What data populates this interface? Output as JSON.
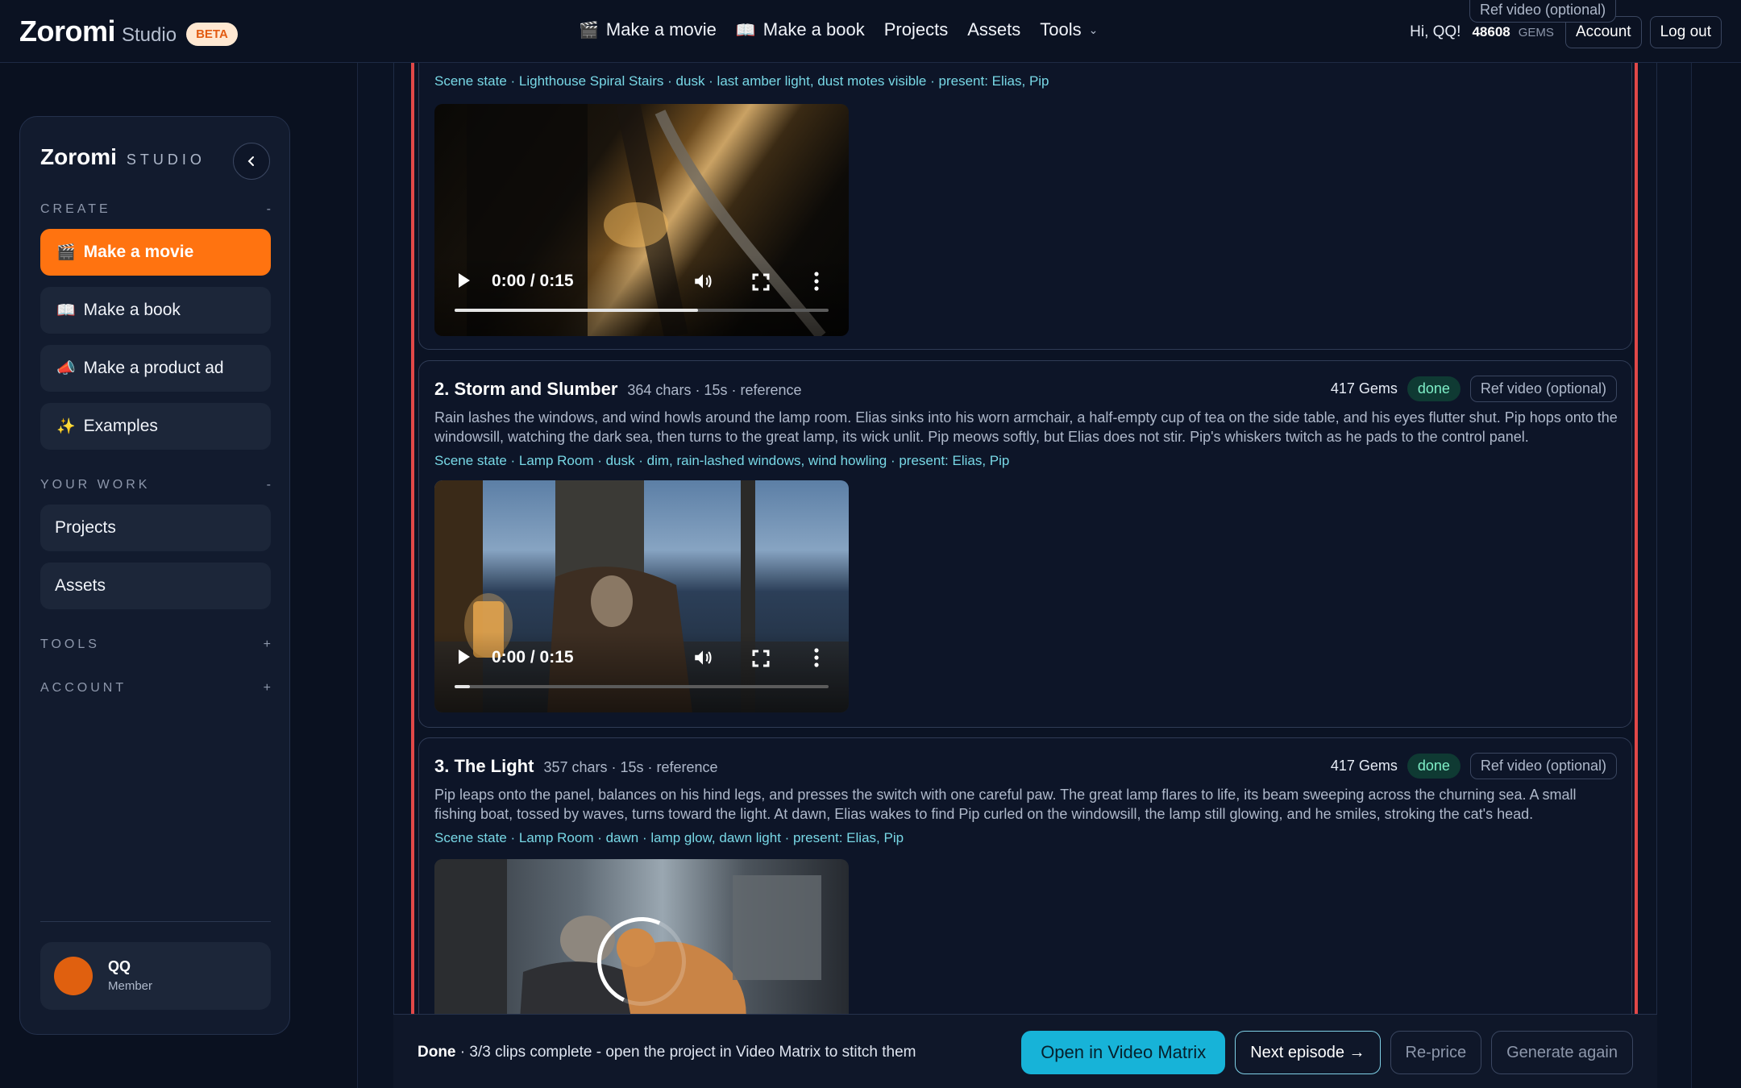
{
  "header": {
    "brand": "Zoromi",
    "brand_sub": "Studio",
    "beta": "BETA",
    "nav": [
      {
        "icon": "clapper-icon",
        "emoji": "🎬",
        "label": "Make a movie"
      },
      {
        "icon": "book-icon",
        "emoji": "📖",
        "label": "Make a book"
      },
      {
        "label": "Projects"
      },
      {
        "label": "Assets"
      },
      {
        "label": "Tools",
        "chevron": "⌄"
      }
    ],
    "greeting": "Hi, QQ!",
    "gems": "48608",
    "gems_unit": "GEMS",
    "account": "Account",
    "logout": "Log out",
    "floating_ref": "Ref video (optional)"
  },
  "sidebar": {
    "title": "Zoromi",
    "sub": "STUDIO",
    "collapse_glyph": "‹",
    "create_label": "CREATE",
    "create_toggle": "-",
    "create_items": [
      {
        "emoji": "🎬",
        "label": "Make a movie"
      },
      {
        "emoji": "📖",
        "label": "Make a book"
      },
      {
        "emoji": "📣",
        "label": "Make a product ad"
      },
      {
        "emoji": "✨",
        "label": "Examples"
      }
    ],
    "work_label": "YOUR WORK",
    "work_toggle": "-",
    "work_items": [
      {
        "label": "Projects"
      },
      {
        "label": "Assets"
      }
    ],
    "tools_label": "TOOLS",
    "tools_toggle": "+",
    "account_label": "ACCOUNT",
    "account_toggle": "+",
    "user": {
      "name": "QQ",
      "role": "Member"
    }
  },
  "clips": [
    {
      "scene": "Scene state · Lighthouse Spiral Stairs · dusk · last amber light, dust motes visible · present: Elias, Pip",
      "time": "0:00 / 0:15",
      "progress": 0.65
    },
    {
      "title": "2. Storm and Slumber",
      "meta": "364 chars · 15s · reference",
      "gems": "417 Gems",
      "status": "done",
      "ref": "Ref video (optional)",
      "desc": "Rain lashes the windows, and wind howls around the lamp room. Elias sinks into his worn armchair, a half-empty cup of tea on the side table, and his eyes flutter shut. Pip hops onto the windowsill, watching the dark sea, then turns to the great lamp, its wick unlit. Pip meows softly, but Elias does not stir. Pip's whiskers twitch as he pads to the control panel.",
      "scene": "Scene state · Lamp Room · dusk · dim, rain-lashed windows, wind howling · present: Elias, Pip",
      "time": "0:00 / 0:15",
      "progress": 0.04
    },
    {
      "title": "3. The Light",
      "meta": "357 chars · 15s · reference",
      "gems": "417 Gems",
      "status": "done",
      "ref": "Ref video (optional)",
      "desc": "Pip leaps onto the panel, balances on his hind legs, and presses the switch with one careful paw. The great lamp flares to life, its beam sweeping across the churning sea. A small fishing boat, tossed by waves, turns toward the light. At dawn, Elias wakes to find Pip curled on the windowsill, the lamp still glowing, and he smiles, stroking the cat's head.",
      "scene": "Scene state · Lamp Room · dawn · lamp glow, dawn light · present: Elias, Pip"
    }
  ],
  "status": {
    "bold": "Done",
    "text": " · 3/3 clips complete - open the project in Video Matrix to stitch them",
    "open": "Open in Video Matrix",
    "next": "Next episode →",
    "reprice": "Re-price",
    "again": "Generate again"
  }
}
